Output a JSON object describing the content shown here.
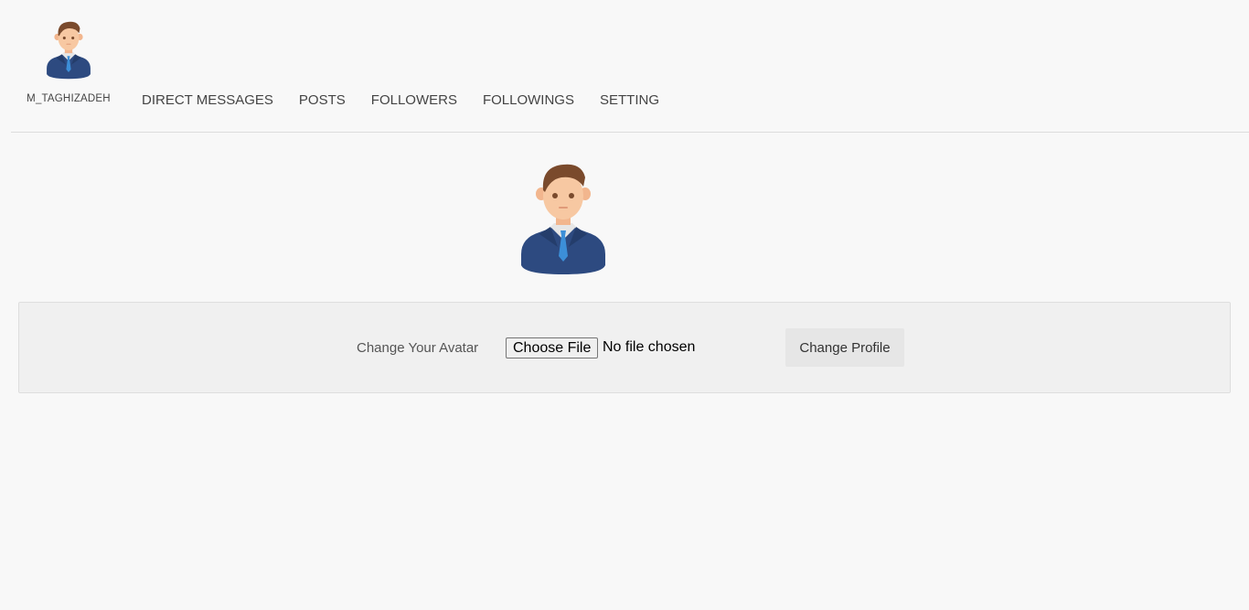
{
  "header": {
    "username": "M_TAGHIZADEH",
    "avatar_icon": "businessman-avatar-icon"
  },
  "nav": {
    "items": [
      {
        "label": "DIRECT MESSAGES"
      },
      {
        "label": "POSTS"
      },
      {
        "label": "FOLLOWERS"
      },
      {
        "label": "FOLLOWINGS"
      },
      {
        "label": "SETTING"
      }
    ]
  },
  "profile": {
    "avatar_icon": "businessman-avatar-icon"
  },
  "form": {
    "label": "Change Your Avatar",
    "file_button_label": "Choose File",
    "file_status": "No file chosen",
    "submit_label": "Change Profile"
  },
  "colors": {
    "background": "#f8f8f8",
    "panel": "#f0f0f0",
    "button": "#e6e6e6",
    "suit": "#2d4a80",
    "tie": "#3c8fd8",
    "hair": "#7a4a2c",
    "skin": "#f7c8a2"
  }
}
